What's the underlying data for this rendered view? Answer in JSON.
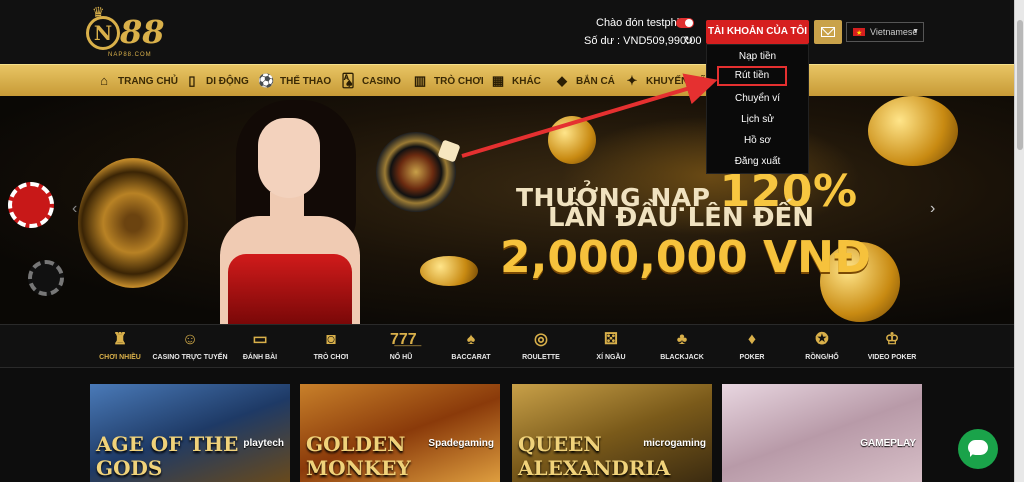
{
  "header": {
    "logo_text": "N88",
    "logo_sub": "NAP88.COM",
    "greeting": "Chào đón testphl",
    "balance": "Số dư : VND509,990.00",
    "account_button": "TÀI KHOẢN CỦA TÔI",
    "language": "Vietnamese"
  },
  "account_menu": {
    "items": [
      "Nạp tiền",
      "Rút tiền",
      "Chuyển ví",
      "Lịch sử",
      "Hồ sơ",
      "Đăng xuất"
    ],
    "highlighted_item": "Rút tiền"
  },
  "nav": {
    "items": [
      {
        "label": "TRANG CHỦ",
        "icon": "home-icon"
      },
      {
        "label": "DI ĐỘNG",
        "icon": "mobile-icon"
      },
      {
        "label": "THỂ THAO",
        "icon": "soccer-icon"
      },
      {
        "label": "CASINO",
        "icon": "cards-icon"
      },
      {
        "label": "TRÒ CHƠI",
        "icon": "slots-icon"
      },
      {
        "label": "KHÁC",
        "icon": "grid-icon"
      },
      {
        "label": "BẮN CÁ",
        "icon": "fish-icon"
      },
      {
        "label": "KHUYẾN MÃI",
        "icon": "gift-icon"
      }
    ]
  },
  "banner": {
    "line1_prefix": "THƯỞNG NẠP",
    "line1_value": "120%",
    "line2": "LẦN ĐẦU LÊN ĐẾN",
    "line3": "2,000,000 VNĐ"
  },
  "categories": [
    {
      "label": "CHƠI NHIỀU",
      "icon": "bowling-icon",
      "active": true
    },
    {
      "label": "CASINO TRỰC TUYẾN",
      "icon": "dealer-icon"
    },
    {
      "label": "ĐÁNH BÀI",
      "icon": "card-table-icon"
    },
    {
      "label": "TRÒ CHƠI",
      "icon": "game-controller-icon"
    },
    {
      "label": "NỔ HŨ",
      "icon": "slot-777-icon"
    },
    {
      "label": "BACCARAT",
      "icon": "baccarat-icon"
    },
    {
      "label": "ROULETTE",
      "icon": "roulette-icon"
    },
    {
      "label": "XÍ NGẦU",
      "icon": "dice-icon"
    },
    {
      "label": "BLACKJACK",
      "icon": "blackjack-icon"
    },
    {
      "label": "POKER",
      "icon": "poker-icon"
    },
    {
      "label": "RỒNG/HỔ",
      "icon": "dragon-tiger-icon"
    },
    {
      "label": "VIDEO POKER",
      "icon": "jester-icon"
    }
  ],
  "games": [
    {
      "title": "AGE OF THE GODS",
      "brand": "playtech"
    },
    {
      "title": "GOLDEN MONKEY",
      "brand": "Spadegaming"
    },
    {
      "title": "QUEEN ALEXANDRIA",
      "brand": "microgaming"
    },
    {
      "title": "",
      "brand": "GAMEPLAY"
    }
  ],
  "colors": {
    "gold": "#d9b04a",
    "red_button": "#d61f1f",
    "nav_gradient_top": "#e8c564",
    "nav_gradient_bottom": "#c79a36",
    "chat_green": "#1aa34a",
    "annotation_red": "#e53030"
  }
}
